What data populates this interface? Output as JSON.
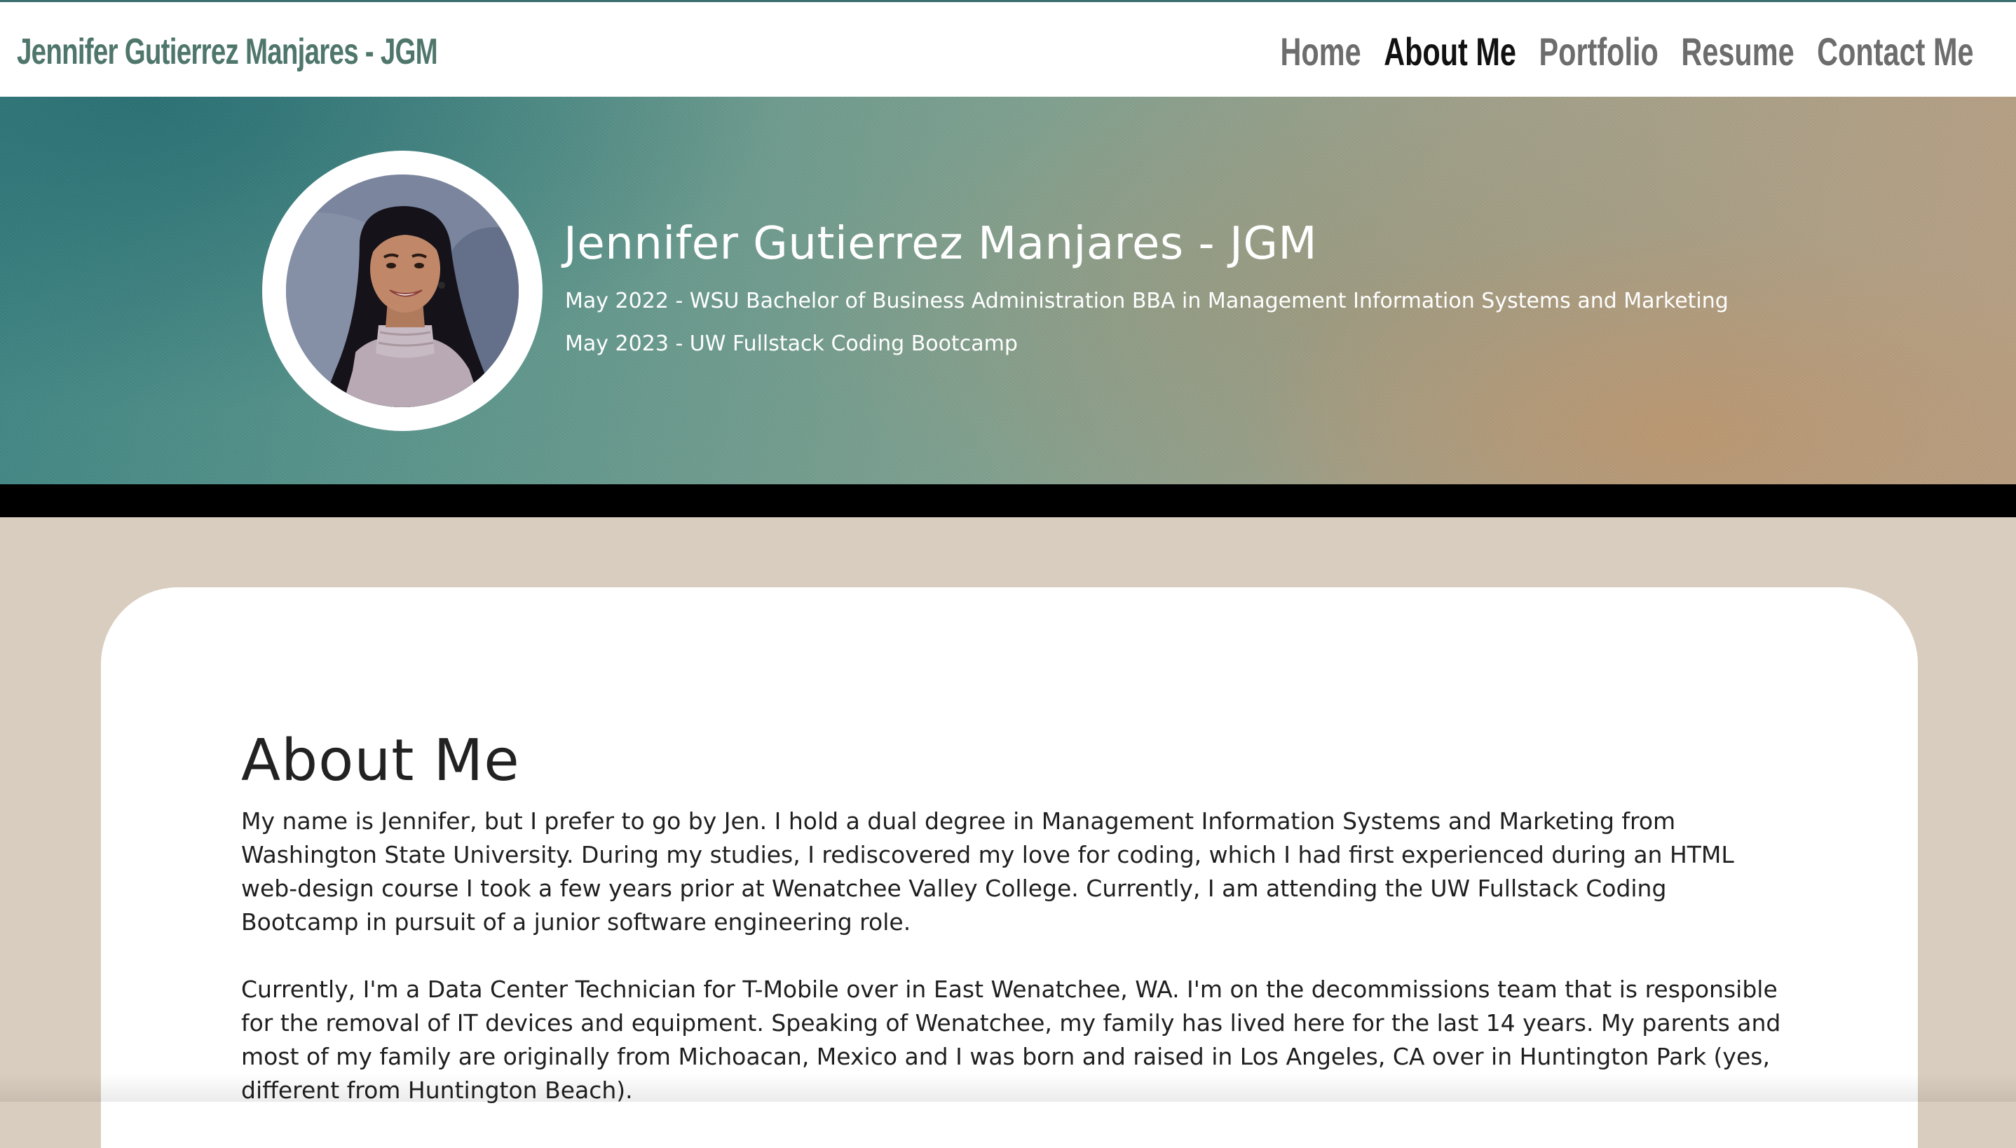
{
  "header": {
    "brand": "Jennifer Gutierrez Manjares - JGM",
    "nav": [
      {
        "label": "Home",
        "active": false
      },
      {
        "label": "About Me",
        "active": true
      },
      {
        "label": "Portfolio",
        "active": false
      },
      {
        "label": "Resume",
        "active": false
      },
      {
        "label": "Contact Me",
        "active": false
      }
    ]
  },
  "hero": {
    "title": "Jennifer Gutierrez Manjares - JGM",
    "lines": [
      "May 2022 - WSU Bachelor of Business Administration BBA in Management Information Systems and Marketing",
      "May 2023 - UW Fullstack Coding Bootcamp"
    ],
    "avatar_icon": "profile-photo"
  },
  "about": {
    "title": "About Me",
    "paragraphs": [
      "My name is Jennifer, but I prefer to go by Jen. I hold a dual degree in Management Information Systems and Marketing from Washington State University. During my studies, I rediscovered my love for coding, which I had first experienced during an HTML web-design course I took a few years prior at Wenatchee Valley College. Currently, I am attending the UW Fullstack Coding Bootcamp in pursuit of a junior software engineering role.",
      "Currently, I'm a Data Center Technician for T-Mobile over in East Wenatchee, WA. I'm on the decommissions team that is responsible for the removal of IT devices and equipment. Speaking of Wenatchee, my family has lived here for the last 14 years. My parents and most of my family are originally from Michoacan, Mexico and I was born and raised in Los Angeles, CA over in Huntington Park (yes, different from Huntington Beach)."
    ]
  },
  "colors": {
    "brand": "#4f766b",
    "nav_text": "#6d6d6d",
    "nav_active": "#111111",
    "page_bg": "#d9cdbf",
    "card_bg": "#ffffff",
    "strip": "#000000"
  }
}
